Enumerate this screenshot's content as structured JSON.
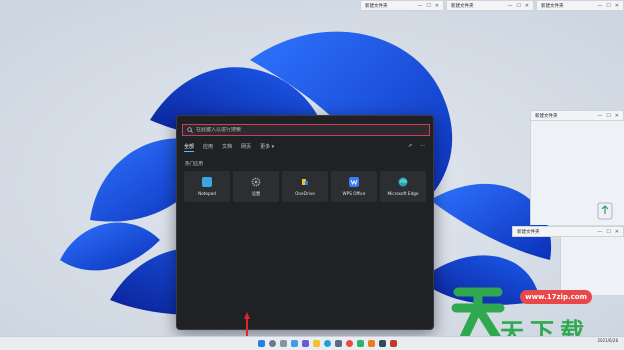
{
  "mini_windows": [
    {
      "title": "新建文件夹",
      "controls": [
        "—",
        "☐",
        "✕"
      ]
    },
    {
      "title": "新建文件夹",
      "controls": [
        "—",
        "☐",
        "✕"
      ]
    },
    {
      "title": "新建文件夹",
      "controls": [
        "—",
        "☐",
        "✕"
      ]
    },
    {
      "title": "新建文件夹",
      "controls": [
        "—",
        "☐",
        "✕"
      ]
    },
    {
      "title": "新建文件夹",
      "controls": [
        "—",
        "☐",
        "✕"
      ]
    }
  ],
  "search": {
    "placeholder": "在此键入以进行搜索",
    "value": ""
  },
  "tabs": [
    "全部",
    "应用",
    "文档",
    "网页",
    "更多 ▾"
  ],
  "tab_icons": [
    "share-icon",
    "more-icon"
  ],
  "tab_glyphs": [
    "⇗",
    "···"
  ],
  "section_title": "热门应用",
  "apps": [
    {
      "label": "Notepad",
      "color": "#3ba7e0"
    },
    {
      "label": "设置",
      "color": "#8a9099"
    },
    {
      "label": "OneDrive",
      "color": "#f2c12e"
    },
    {
      "label": "WPS Office",
      "color": "#3b7cf0"
    },
    {
      "label": "Microsoft Edge",
      "color": "#1fa0d8"
    }
  ],
  "watermark": {
    "url": "www.17zip.com",
    "text": "天下载"
  },
  "tray": {
    "time": "",
    "date": "2021/6/28"
  },
  "colors": {
    "panel_bg": "#202124",
    "search_border": "#d23c55",
    "accent": "#4cc2ff"
  }
}
